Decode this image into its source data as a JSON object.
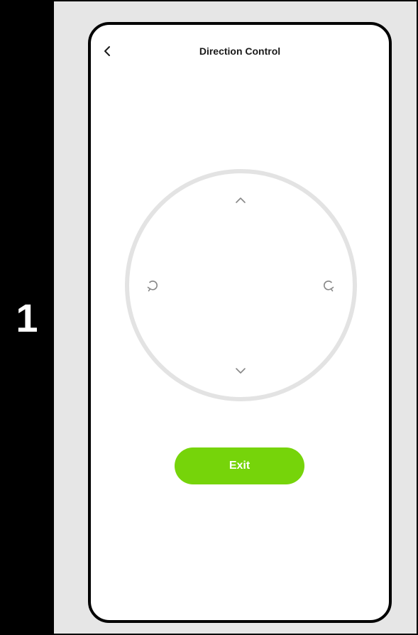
{
  "step": {
    "number": "1"
  },
  "screen": {
    "title": "Direction Control",
    "back_icon": "chevron-left-icon"
  },
  "direction_pad": {
    "up_icon": "chevron-up-icon",
    "down_icon": "chevron-down-icon",
    "left_icon": "rotate-counterclockwise-icon",
    "right_icon": "rotate-clockwise-icon"
  },
  "exit_button": {
    "label": "Exit"
  },
  "colors": {
    "accent": "#76d40a",
    "ring": "#e3e3e3",
    "icon": "#888888",
    "background_panel": "#e6e6e6",
    "step_bar": "#000000"
  }
}
